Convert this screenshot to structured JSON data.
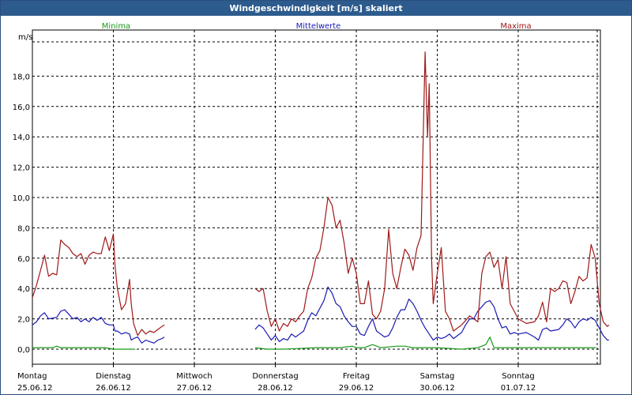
{
  "window": {
    "title": "Windgeschwindigkeit [m/s] skaliert"
  },
  "chart_data": {
    "type": "line",
    "ylabel": "m/s",
    "ylim": [
      -1.0,
      20.7
    ],
    "yticks": [
      "0,0",
      "2,0",
      "4,0",
      "6,0",
      "8,0",
      "10,0",
      "12,0",
      "14,0",
      "16,0",
      "18,0"
    ],
    "xlim": [
      0,
      7
    ],
    "days": [
      {
        "name": "Montag",
        "date": "25.06.12"
      },
      {
        "name": "Dienstag",
        "date": "26.06.12"
      },
      {
        "name": "Mittwoch",
        "date": "27.06.12"
      },
      {
        "name": "Donnerstag",
        "date": "28.06.12"
      },
      {
        "name": "Freitag",
        "date": "29.06.12"
      },
      {
        "name": "Samstag",
        "date": "30.06.12"
      },
      {
        "name": "Sonntag",
        "date": "01.07.12"
      }
    ],
    "grid": true,
    "series": [
      {
        "name": "Minima",
        "color": "#1a9a1a",
        "segments": [
          [
            [
              0.0,
              0.1
            ],
            [
              0.25,
              0.1
            ],
            [
              0.3,
              0.2
            ],
            [
              0.35,
              0.1
            ],
            [
              0.6,
              0.1
            ],
            [
              0.75,
              0.1
            ],
            [
              0.9,
              0.1
            ],
            [
              1.0,
              0.0
            ],
            [
              1.1,
              0.0
            ],
            [
              1.2,
              0.0
            ],
            [
              1.27,
              0.0
            ]
          ],
          [
            [
              2.75,
              0.1
            ],
            [
              2.9,
              0.0
            ],
            [
              3.1,
              0.0
            ],
            [
              3.5,
              0.1
            ],
            [
              3.8,
              0.1
            ],
            [
              3.95,
              0.2
            ],
            [
              4.0,
              0.1
            ],
            [
              4.1,
              0.1
            ],
            [
              4.2,
              0.3
            ],
            [
              4.3,
              0.1
            ],
            [
              4.5,
              0.2
            ],
            [
              4.6,
              0.2
            ],
            [
              4.7,
              0.1
            ],
            [
              5.0,
              0.1
            ],
            [
              5.3,
              0.0
            ],
            [
              5.5,
              0.1
            ],
            [
              5.6,
              0.3
            ],
            [
              5.65,
              0.8
            ],
            [
              5.7,
              0.1
            ],
            [
              6.0,
              0.1
            ],
            [
              6.4,
              0.1
            ],
            [
              6.7,
              0.1
            ],
            [
              6.96,
              0.1
            ]
          ]
        ]
      },
      {
        "name": "Mittelwerte",
        "color": "#1a1ab4",
        "segments": [
          [
            [
              0.0,
              1.6
            ],
            [
              0.05,
              1.8
            ],
            [
              0.1,
              2.2
            ],
            [
              0.15,
              2.4
            ],
            [
              0.2,
              2.0
            ],
            [
              0.3,
              2.1
            ],
            [
              0.35,
              2.5
            ],
            [
              0.4,
              2.6
            ],
            [
              0.45,
              2.3
            ],
            [
              0.5,
              2.0
            ],
            [
              0.55,
              2.1
            ],
            [
              0.6,
              1.8
            ],
            [
              0.65,
              2.0
            ],
            [
              0.7,
              1.8
            ],
            [
              0.75,
              2.1
            ],
            [
              0.8,
              1.9
            ],
            [
              0.85,
              2.1
            ],
            [
              0.9,
              1.7
            ],
            [
              0.95,
              1.6
            ],
            [
              1.0,
              1.6
            ],
            [
              1.02,
              1.2
            ],
            [
              1.05,
              1.2
            ],
            [
              1.1,
              1.0
            ],
            [
              1.15,
              1.1
            ],
            [
              1.2,
              1.0
            ],
            [
              1.22,
              0.6
            ],
            [
              1.25,
              0.7
            ],
            [
              1.3,
              0.8
            ],
            [
              1.35,
              0.4
            ],
            [
              1.4,
              0.6
            ],
            [
              1.45,
              0.5
            ],
            [
              1.5,
              0.4
            ],
            [
              1.55,
              0.6
            ],
            [
              1.6,
              0.7
            ],
            [
              1.63,
              0.8
            ]
          ],
          [
            [
              2.75,
              1.3
            ],
            [
              2.8,
              1.6
            ],
            [
              2.85,
              1.4
            ],
            [
              2.9,
              1.0
            ],
            [
              2.95,
              0.6
            ],
            [
              3.0,
              0.9
            ],
            [
              3.05,
              0.5
            ],
            [
              3.1,
              0.7
            ],
            [
              3.15,
              0.6
            ],
            [
              3.2,
              1.0
            ],
            [
              3.25,
              0.8
            ],
            [
              3.3,
              1.0
            ],
            [
              3.35,
              1.2
            ],
            [
              3.4,
              1.9
            ],
            [
              3.45,
              2.4
            ],
            [
              3.5,
              2.2
            ],
            [
              3.55,
              2.7
            ],
            [
              3.6,
              3.2
            ],
            [
              3.65,
              4.1
            ],
            [
              3.7,
              3.7
            ],
            [
              3.75,
              3.0
            ],
            [
              3.8,
              2.8
            ],
            [
              3.85,
              2.2
            ],
            [
              3.9,
              1.8
            ],
            [
              3.95,
              1.5
            ],
            [
              4.0,
              1.5
            ],
            [
              4.05,
              1.0
            ],
            [
              4.1,
              0.9
            ],
            [
              4.15,
              1.5
            ],
            [
              4.2,
              2.0
            ],
            [
              4.25,
              1.2
            ],
            [
              4.3,
              1.0
            ],
            [
              4.35,
              0.8
            ],
            [
              4.4,
              0.9
            ],
            [
              4.45,
              1.4
            ],
            [
              4.5,
              2.1
            ],
            [
              4.55,
              2.6
            ],
            [
              4.6,
              2.6
            ],
            [
              4.65,
              3.3
            ],
            [
              4.7,
              3.0
            ],
            [
              4.75,
              2.5
            ],
            [
              4.8,
              1.9
            ],
            [
              4.85,
              1.4
            ],
            [
              4.9,
              1.0
            ],
            [
              4.95,
              0.6
            ],
            [
              5.0,
              0.8
            ],
            [
              5.05,
              0.7
            ],
            [
              5.1,
              0.8
            ],
            [
              5.15,
              1.0
            ],
            [
              5.2,
              0.7
            ],
            [
              5.3,
              1.1
            ],
            [
              5.35,
              1.6
            ],
            [
              5.4,
              2.0
            ],
            [
              5.45,
              2.0
            ],
            [
              5.5,
              2.5
            ],
            [
              5.55,
              2.8
            ],
            [
              5.6,
              3.1
            ],
            [
              5.65,
              3.2
            ],
            [
              5.7,
              2.8
            ],
            [
              5.75,
              2.0
            ],
            [
              5.8,
              1.4
            ],
            [
              5.85,
              1.5
            ],
            [
              5.9,
              1.0
            ],
            [
              5.95,
              1.1
            ],
            [
              6.0,
              1.0
            ],
            [
              6.1,
              1.1
            ],
            [
              6.2,
              0.8
            ],
            [
              6.25,
              0.6
            ],
            [
              6.3,
              1.3
            ],
            [
              6.35,
              1.4
            ],
            [
              6.4,
              1.2
            ],
            [
              6.5,
              1.3
            ],
            [
              6.55,
              1.6
            ],
            [
              6.6,
              2.0
            ],
            [
              6.65,
              1.8
            ],
            [
              6.7,
              1.4
            ],
            [
              6.75,
              1.8
            ],
            [
              6.8,
              2.0
            ],
            [
              6.85,
              1.9
            ],
            [
              6.9,
              2.1
            ],
            [
              6.95,
              1.9
            ],
            [
              7.0,
              1.4
            ],
            [
              7.05,
              0.9
            ],
            [
              7.1,
              0.6
            ],
            [
              7.12,
              0.6
            ]
          ]
        ]
      },
      {
        "name": "Maxima",
        "color": "#a01818",
        "segments": [
          [
            [
              0.0,
              3.4
            ],
            [
              0.05,
              4.2
            ],
            [
              0.1,
              5.2
            ],
            [
              0.15,
              6.2
            ],
            [
              0.2,
              4.8
            ],
            [
              0.25,
              5.0
            ],
            [
              0.3,
              4.9
            ],
            [
              0.35,
              7.2
            ],
            [
              0.4,
              6.9
            ],
            [
              0.45,
              6.7
            ],
            [
              0.5,
              6.3
            ],
            [
              0.55,
              6.1
            ],
            [
              0.6,
              6.3
            ],
            [
              0.65,
              5.6
            ],
            [
              0.7,
              6.2
            ],
            [
              0.75,
              6.4
            ],
            [
              0.8,
              6.3
            ],
            [
              0.85,
              6.3
            ],
            [
              0.9,
              7.4
            ],
            [
              0.95,
              6.5
            ],
            [
              1.0,
              7.6
            ],
            [
              1.02,
              5.5
            ],
            [
              1.05,
              4.0
            ],
            [
              1.1,
              2.6
            ],
            [
              1.15,
              3.0
            ],
            [
              1.2,
              4.6
            ],
            [
              1.22,
              3.0
            ],
            [
              1.25,
              1.7
            ],
            [
              1.3,
              0.9
            ],
            [
              1.35,
              1.3
            ],
            [
              1.4,
              1.0
            ],
            [
              1.45,
              1.2
            ],
            [
              1.5,
              1.1
            ],
            [
              1.55,
              1.3
            ],
            [
              1.6,
              1.5
            ],
            [
              1.63,
              1.6
            ]
          ],
          [
            [
              2.75,
              4.0
            ],
            [
              2.8,
              3.8
            ],
            [
              2.85,
              4.0
            ],
            [
              2.9,
              2.5
            ],
            [
              2.95,
              1.5
            ],
            [
              3.0,
              2.0
            ],
            [
              3.05,
              1.2
            ],
            [
              3.1,
              1.7
            ],
            [
              3.15,
              1.5
            ],
            [
              3.2,
              2.0
            ],
            [
              3.25,
              1.8
            ],
            [
              3.3,
              2.2
            ],
            [
              3.35,
              2.5
            ],
            [
              3.4,
              4.0
            ],
            [
              3.45,
              4.7
            ],
            [
              3.5,
              6.0
            ],
            [
              3.55,
              6.5
            ],
            [
              3.6,
              8.0
            ],
            [
              3.65,
              10.0
            ],
            [
              3.7,
              9.5
            ],
            [
              3.75,
              8.0
            ],
            [
              3.8,
              8.5
            ],
            [
              3.85,
              7.0
            ],
            [
              3.9,
              5.0
            ],
            [
              3.95,
              6.0
            ],
            [
              4.0,
              5.0
            ],
            [
              4.05,
              3.0
            ],
            [
              4.1,
              3.0
            ],
            [
              4.15,
              4.5
            ],
            [
              4.2,
              2.3
            ],
            [
              4.25,
              2.0
            ],
            [
              4.3,
              2.5
            ],
            [
              4.35,
              4.0
            ],
            [
              4.4,
              7.9
            ],
            [
              4.45,
              5.0
            ],
            [
              4.5,
              4.0
            ],
            [
              4.55,
              5.4
            ],
            [
              4.6,
              6.6
            ],
            [
              4.65,
              6.2
            ],
            [
              4.7,
              5.2
            ],
            [
              4.75,
              6.7
            ],
            [
              4.8,
              7.5
            ],
            [
              4.85,
              19.6
            ],
            [
              4.88,
              14.0
            ],
            [
              4.9,
              17.5
            ],
            [
              4.93,
              6.0
            ],
            [
              4.95,
              3.0
            ],
            [
              5.0,
              5.0
            ],
            [
              5.05,
              6.7
            ],
            [
              5.1,
              2.5
            ],
            [
              5.15,
              2.0
            ],
            [
              5.2,
              1.2
            ],
            [
              5.3,
              1.6
            ],
            [
              5.4,
              2.2
            ],
            [
              5.5,
              1.8
            ],
            [
              5.55,
              5.0
            ],
            [
              5.6,
              6.1
            ],
            [
              5.65,
              6.4
            ],
            [
              5.7,
              5.4
            ],
            [
              5.75,
              5.9
            ],
            [
              5.8,
              4.0
            ],
            [
              5.85,
              6.1
            ],
            [
              5.9,
              3.0
            ],
            [
              5.95,
              2.5
            ],
            [
              6.0,
              2.0
            ],
            [
              6.1,
              1.7
            ],
            [
              6.2,
              1.8
            ],
            [
              6.25,
              2.2
            ],
            [
              6.3,
              3.1
            ],
            [
              6.35,
              1.8
            ],
            [
              6.4,
              4.0
            ],
            [
              6.45,
              3.8
            ],
            [
              6.5,
              4.0
            ],
            [
              6.55,
              4.5
            ],
            [
              6.6,
              4.4
            ],
            [
              6.65,
              3.0
            ],
            [
              6.7,
              3.8
            ],
            [
              6.75,
              4.8
            ],
            [
              6.8,
              4.5
            ],
            [
              6.85,
              4.7
            ],
            [
              6.9,
              6.9
            ],
            [
              6.95,
              6.0
            ],
            [
              7.0,
              3.0
            ],
            [
              7.05,
              1.8
            ],
            [
              7.1,
              1.5
            ],
            [
              7.12,
              1.6
            ]
          ]
        ]
      }
    ]
  }
}
